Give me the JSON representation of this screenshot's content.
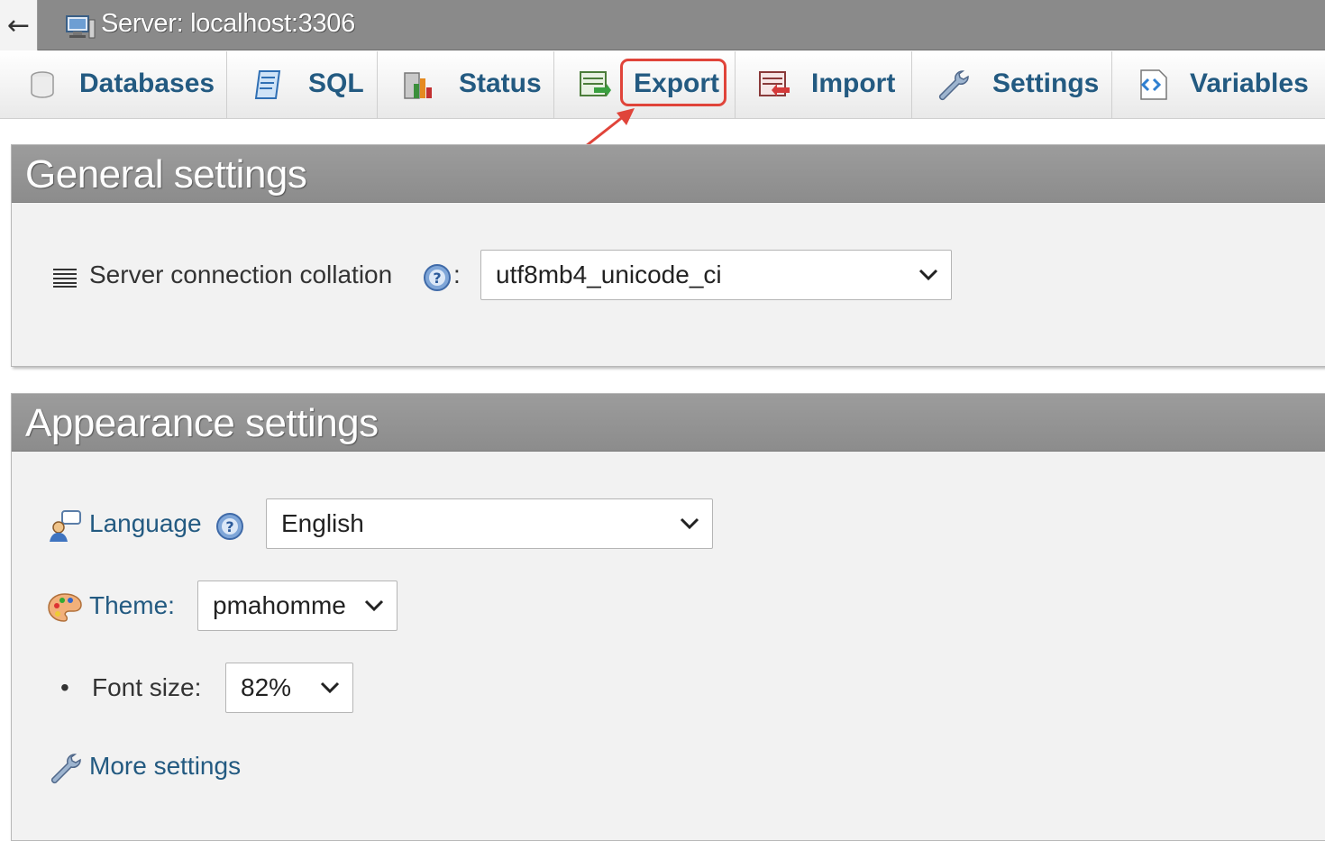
{
  "topbar": {
    "back_label": "←",
    "server_label": "Server: localhost:3306"
  },
  "tabs": [
    {
      "label": "Databases",
      "icon": "database-icon"
    },
    {
      "label": "SQL",
      "icon": "sql-icon"
    },
    {
      "label": "Status",
      "icon": "status-icon"
    },
    {
      "label": "Export",
      "icon": "export-icon",
      "highlighted": true
    },
    {
      "label": "Import",
      "icon": "import-icon"
    },
    {
      "label": "Settings",
      "icon": "wrench-icon"
    },
    {
      "label": "Variables",
      "icon": "variables-icon"
    }
  ],
  "general": {
    "title": "General settings",
    "collation_label": "Server connection collation",
    "collation_colon": ":",
    "collation_value": "utf8mb4_unicode_ci"
  },
  "appearance": {
    "title": "Appearance settings",
    "language_label": "Language",
    "language_value": "English",
    "theme_label": "Theme:",
    "theme_value": "pmahomme",
    "bullet": "•",
    "fontsize_label": "Font size:",
    "fontsize_value": "82%",
    "more_settings": "More settings"
  },
  "colors": {
    "tab_text": "#235a81",
    "highlight": "#e0443a",
    "header_gray": "#8a8a8a"
  }
}
